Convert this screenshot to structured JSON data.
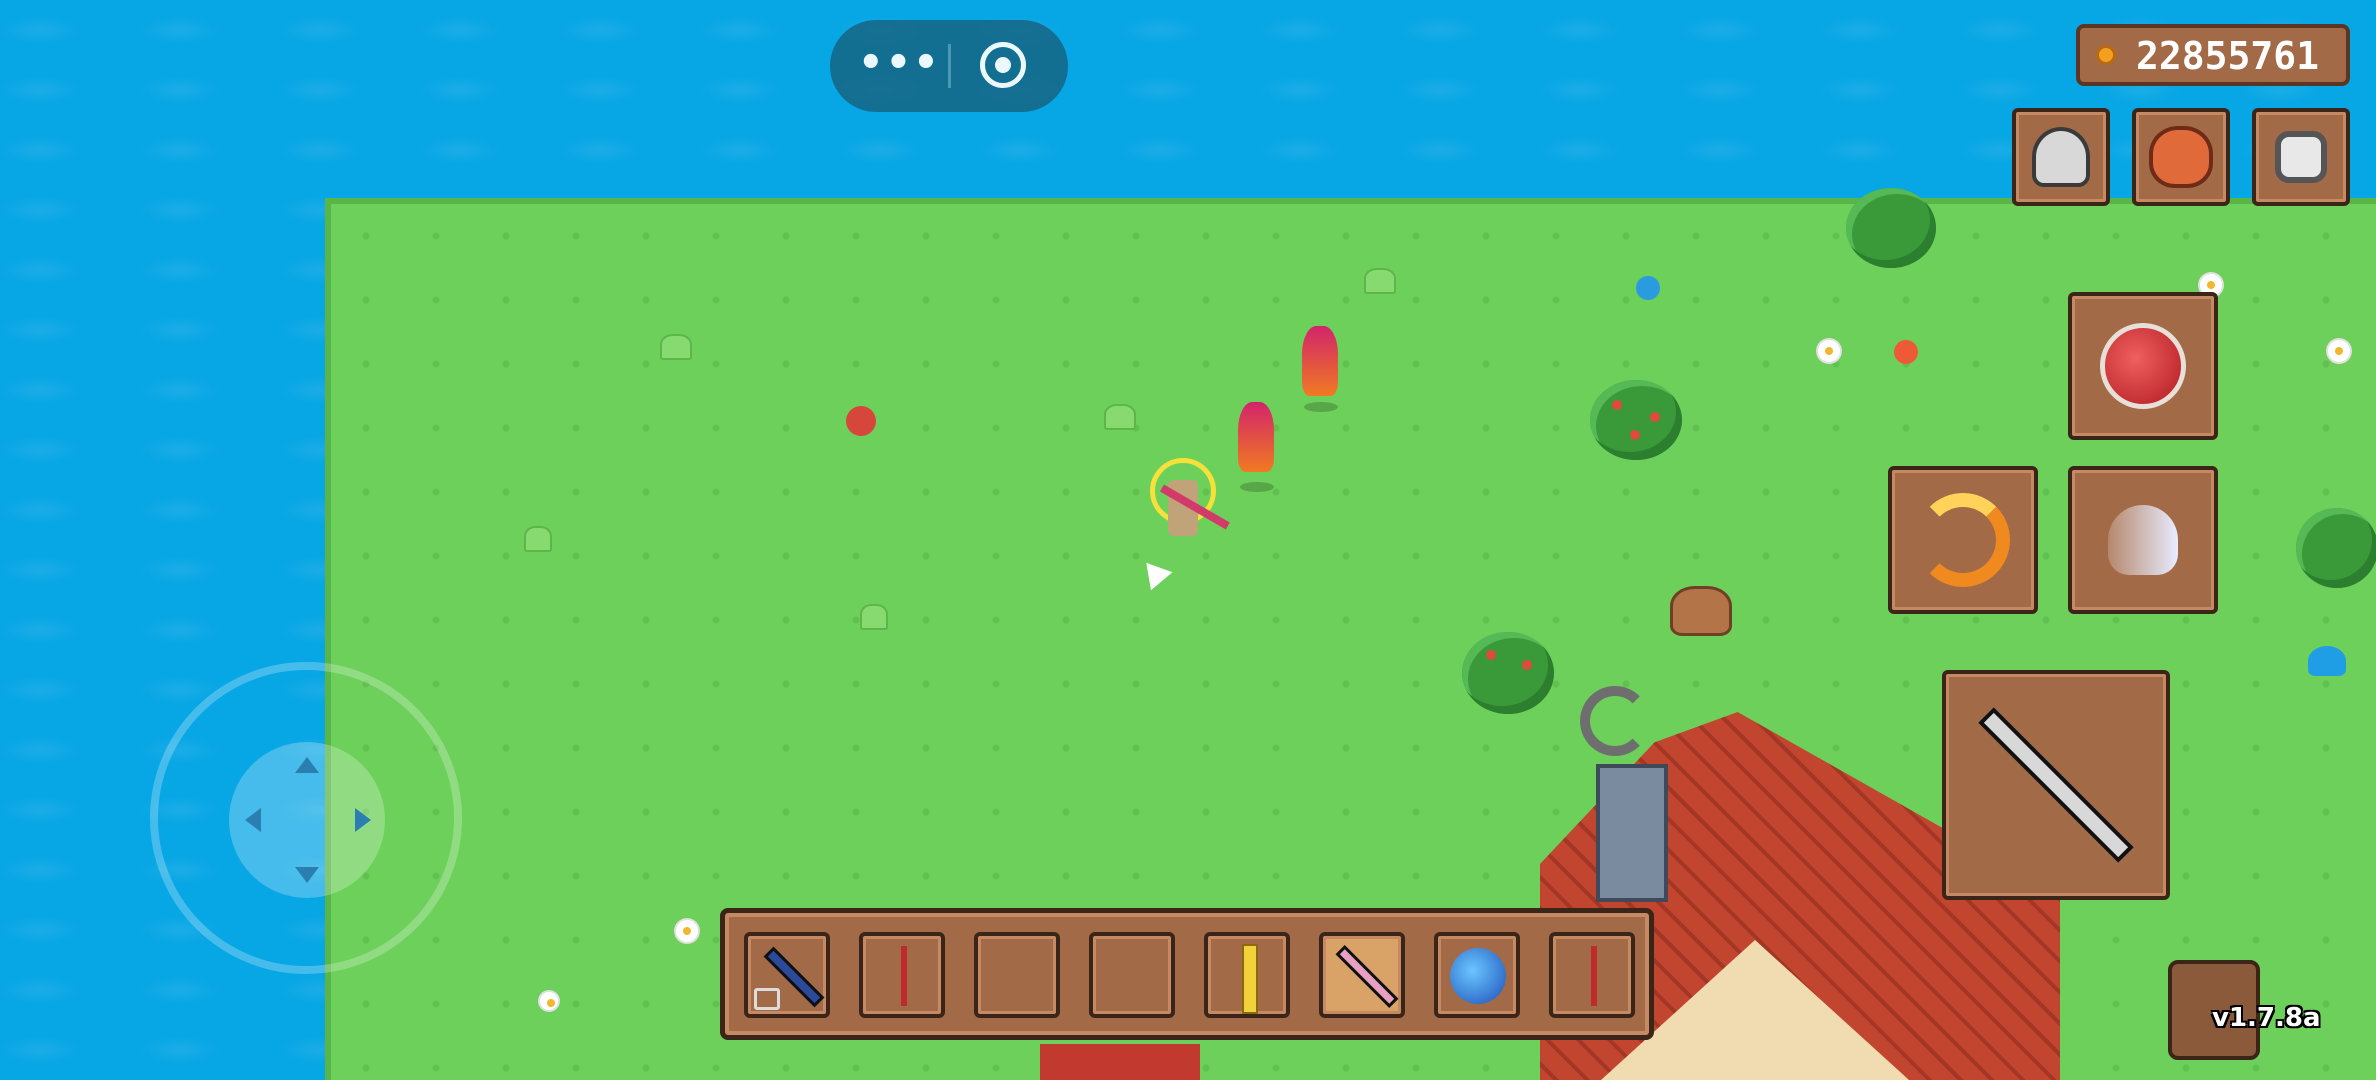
{
  "hud": {
    "coins": "22855761",
    "version": "v1.7.8a"
  },
  "top_pill": {
    "menu_icon": "more-dots-icon",
    "capture_icon": "target-circle-icon"
  },
  "menu_buttons": [
    {
      "name": "character",
      "icon": "helmet-icon"
    },
    {
      "name": "bag",
      "icon": "pouch-icon"
    },
    {
      "name": "settings",
      "icon": "gear-icon"
    }
  ],
  "skills": [
    {
      "name": "health-potion",
      "icon": "potion-icon"
    },
    {
      "name": "fire-slash",
      "icon": "flame-slash-icon"
    },
    {
      "name": "dash",
      "icon": "ghost-dash-icon"
    }
  ],
  "attack": {
    "icon": "staff-icon"
  },
  "hotbar": {
    "slots": [
      {
        "icon": "blue-staff-icon",
        "locked": true,
        "selected": false
      },
      {
        "icon": "red-wand-icon",
        "locked": false,
        "selected": false
      },
      {
        "icon": "",
        "locked": false,
        "selected": false
      },
      {
        "icon": "",
        "locked": false,
        "selected": false
      },
      {
        "icon": "golden-staff-icon",
        "locked": false,
        "selected": false
      },
      {
        "icon": "pink-staff-icon",
        "locked": false,
        "selected": true
      },
      {
        "icon": "blue-orb-icon",
        "locked": false,
        "selected": false
      },
      {
        "icon": "red-wand-icon",
        "locked": false,
        "selected": false
      }
    ]
  },
  "colors": {
    "water": "#07a6e5",
    "grass": "#6dd05a",
    "panel": "#a36a48",
    "panel_border": "#3b2418"
  }
}
